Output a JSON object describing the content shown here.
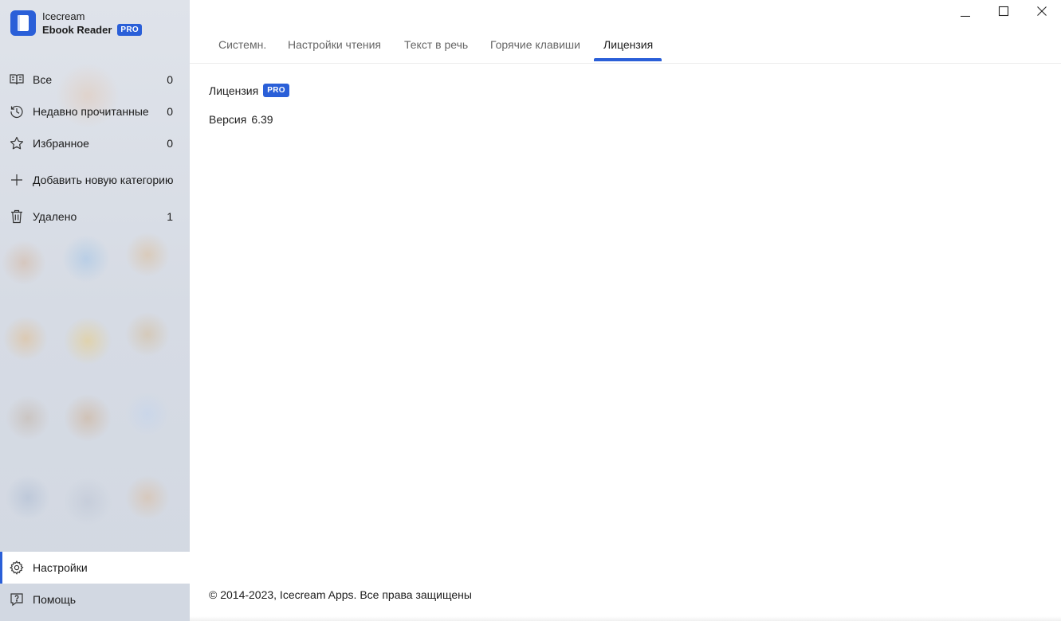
{
  "app": {
    "name_line1": "Icecream",
    "name_line2": "Ebook Reader",
    "pro_badge": "PRO",
    "accent_color": "#2a5fd8"
  },
  "sidebar": {
    "items": [
      {
        "label": "Все",
        "count": "0",
        "icon": "library-icon"
      },
      {
        "label": "Недавно прочитанные",
        "count": "0",
        "icon": "history-icon"
      },
      {
        "label": "Избранное",
        "count": "0",
        "icon": "star-icon"
      },
      {
        "label": "Добавить новую категорию",
        "count": "",
        "icon": "plus-icon"
      },
      {
        "label": "Удалено",
        "count": "1",
        "icon": "trash-icon"
      }
    ],
    "bottom": [
      {
        "label": "Настройки",
        "icon": "gear-icon",
        "active": true
      },
      {
        "label": "Помощь",
        "icon": "help-icon",
        "active": false
      }
    ]
  },
  "window_controls": [
    "minimize-icon",
    "maximize-icon",
    "close-icon"
  ],
  "tabs": [
    {
      "label": "Системн.",
      "active": false
    },
    {
      "label": "Настройки чтения",
      "active": false
    },
    {
      "label": "Текст в речь",
      "active": false
    },
    {
      "label": "Горячие клавиши",
      "active": false
    },
    {
      "label": "Лицензия",
      "active": true
    }
  ],
  "license": {
    "label": "Лицензия",
    "badge": "PRO",
    "version_label": "Версия",
    "version_value": "6.39"
  },
  "footer": {
    "copyright": "© 2014-2023, Icecream Apps. Все права защищены"
  }
}
